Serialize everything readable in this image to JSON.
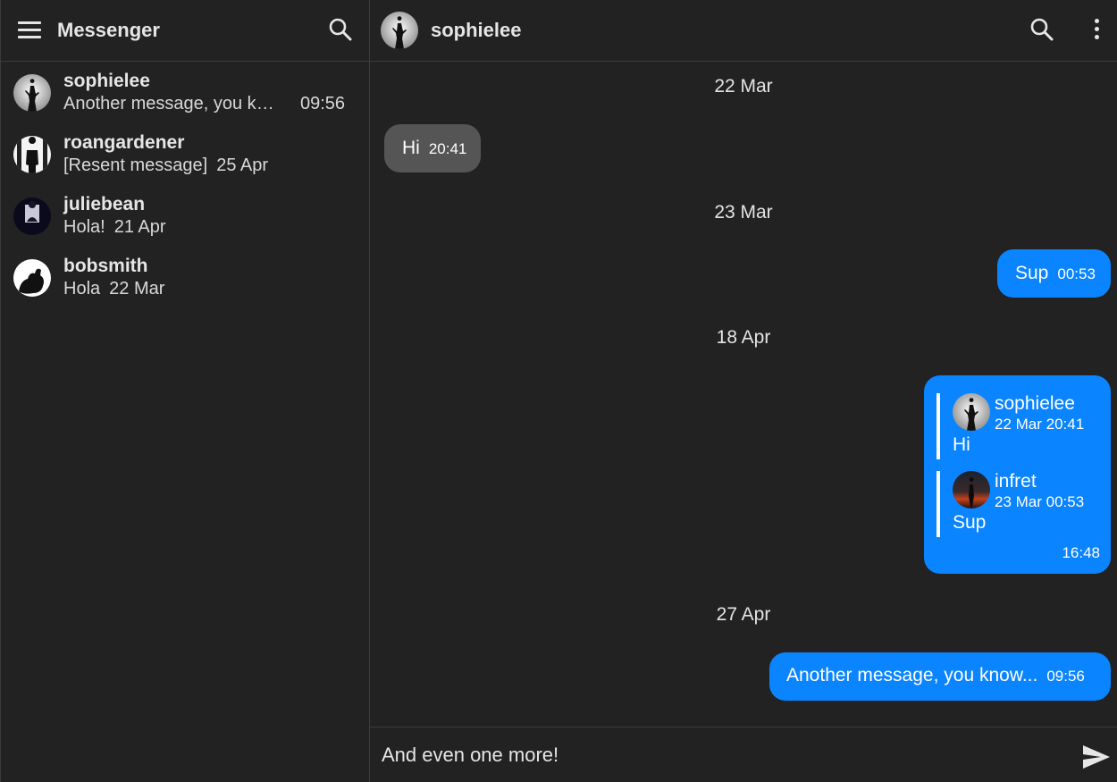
{
  "sidebar": {
    "title": "Messenger",
    "conversations": [
      {
        "name": "sophielee",
        "preview": "Another message, you know...",
        "time": "09:56"
      },
      {
        "name": "roangardener",
        "preview": "[Resent message]",
        "time": "25 Apr"
      },
      {
        "name": "juliebean",
        "preview": "Hola!",
        "time": "21 Apr"
      },
      {
        "name": "bobsmith",
        "preview": "Hola",
        "time": "22 Mar"
      }
    ]
  },
  "chat": {
    "title": "sophielee",
    "dates": [
      "22 Mar",
      "23 Mar",
      "18 Apr",
      "27 Apr"
    ],
    "messages": [
      {
        "text": "Hi",
        "time": "20:41",
        "direction": "incoming"
      },
      {
        "text": "Sup",
        "time": "00:53",
        "direction": "outgoing"
      },
      {
        "direction": "outgoing",
        "time": "16:48",
        "forwarded": [
          {
            "author": "sophielee",
            "datetime": "22 Mar 20:41",
            "text": "Hi"
          },
          {
            "author": "infret",
            "datetime": "23 Mar 00:53",
            "text": "Sup"
          }
        ]
      },
      {
        "text": "Another message, you know...",
        "time": "09:56",
        "direction": "outgoing"
      }
    ]
  },
  "composer": {
    "value": "And even one more!"
  },
  "colors": {
    "background": "#222222",
    "outgoing_bubble": "#0a84ff",
    "incoming_bubble": "#555555",
    "divider": "#3c3c3c"
  },
  "icons": {
    "menu": "menu-icon",
    "search": "search-icon",
    "more": "more-vertical-icon",
    "send": "send-icon"
  }
}
